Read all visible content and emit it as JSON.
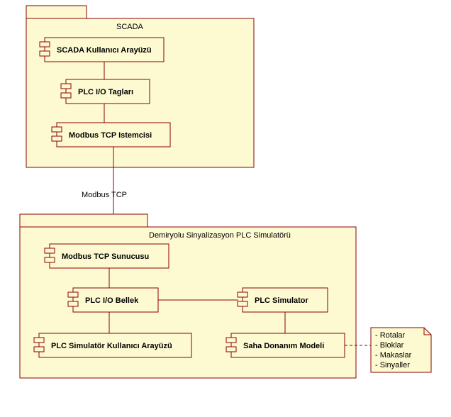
{
  "packages": {
    "scada": {
      "title": "SCADA"
    },
    "sim": {
      "title": "Demiryolu Sinyalizasyon PLC Simulatörü"
    }
  },
  "components": {
    "scada_ui": {
      "label": "SCADA Kullanıcı Arayüzü"
    },
    "plc_tags": {
      "label": "PLC I/O Tagları"
    },
    "mb_client": {
      "label": "Modbus TCP Istemcisi"
    },
    "mb_server": {
      "label": "Modbus TCP Sunucusu"
    },
    "plc_memory": {
      "label": "PLC I/O Bellek"
    },
    "plc_sim": {
      "label": "PLC Simulator"
    },
    "plc_sim_ui": {
      "label": "PLC Simulatör Kullanıcı Arayüzü"
    },
    "field_model": {
      "label": "Saha Donanım Modeli"
    }
  },
  "connectors": {
    "modbus_tcp": {
      "label": "Modbus TCP"
    }
  },
  "note": {
    "lines": [
      "- Rotalar",
      "- Bloklar",
      "- Makaslar",
      "- Sinyaller"
    ]
  }
}
